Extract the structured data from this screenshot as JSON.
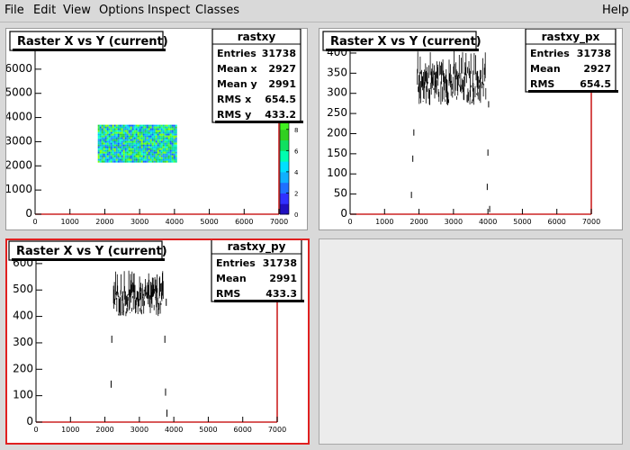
{
  "menu": {
    "file": "File",
    "edit": "Edit",
    "view": "View",
    "options": "Options",
    "inspect": "Inspect",
    "classes": "Classes",
    "help": "Help"
  },
  "pads": {
    "top_left": {
      "title": "Raster X vs Y (current)",
      "stats": {
        "name": "rastxy",
        "rows": [
          [
            "Entries",
            "31738"
          ],
          [
            "Mean x",
            "2927"
          ],
          [
            "Mean y",
            "2991"
          ],
          [
            "RMS x",
            "654.5"
          ],
          [
            "RMS y",
            "433.2"
          ]
        ]
      },
      "x_ticks": [
        "0",
        "1000",
        "2000",
        "3000",
        "4000",
        "5000",
        "6000",
        "7000"
      ],
      "y_ticks": [
        "0",
        "1000",
        "2000",
        "3000",
        "4000",
        "5000",
        "6000"
      ],
      "z_ticks": [
        "0",
        "2",
        "4",
        "6",
        "8"
      ]
    },
    "top_right": {
      "title": "Raster X vs Y (current)",
      "stats": {
        "name": "rastxy_px",
        "rows": [
          [
            "Entries",
            "31738"
          ],
          [
            "Mean",
            "2927"
          ],
          [
            "RMS",
            "654.5"
          ]
        ]
      },
      "x_ticks": [
        "0",
        "1000",
        "2000",
        "3000",
        "4000",
        "5000",
        "6000",
        "7000"
      ],
      "y_ticks": [
        "0",
        "50",
        "100",
        "150",
        "200",
        "250",
        "300",
        "350",
        "400"
      ]
    },
    "bottom_left": {
      "title": "Raster X vs Y (current)",
      "stats": {
        "name": "rastxy_py",
        "rows": [
          [
            "Entries",
            "31738"
          ],
          [
            "Mean",
            "2991"
          ],
          [
            "RMS",
            "433.3"
          ]
        ]
      },
      "x_ticks": [
        "0",
        "1000",
        "2000",
        "3000",
        "4000",
        "5000",
        "6000",
        "7000"
      ],
      "y_ticks": [
        "0",
        "100",
        "200",
        "300",
        "400",
        "500",
        "600"
      ]
    }
  },
  "colors": {
    "histogram_line": "#000000",
    "axis_frame": "#cc2222",
    "active_pad_border": "#e02020"
  },
  "chart_data": [
    {
      "type": "heatmap",
      "title": "Raster X vs Y (current)",
      "xlim": [
        0,
        7000
      ],
      "ylim": [
        0,
        7000
      ],
      "zlim": [
        0,
        9
      ],
      "filled_region": {
        "x": [
          1800,
          4050
        ],
        "y": [
          2200,
          3700
        ]
      },
      "stats": {
        "Entries": 31738,
        "Mean x": 2927,
        "Mean y": 2991,
        "RMS x": 654.5,
        "RMS y": 433.2
      }
    },
    {
      "type": "line",
      "title": "Raster X vs Y (current)",
      "xlim": [
        0,
        7000
      ],
      "ylim": [
        0,
        420
      ],
      "band": {
        "x": [
          1950,
          3950
        ],
        "y_min": 270,
        "y_max": 420
      },
      "edge_points": [
        [
          1780,
          40
        ],
        [
          1820,
          130
        ],
        [
          1850,
          195
        ],
        [
          3980,
          60
        ],
        [
          4000,
          145
        ],
        [
          4020,
          265
        ],
        [
          4050,
          5
        ]
      ],
      "stats": {
        "Entries": 31738,
        "Mean": 2927,
        "RMS": 654.5
      }
    },
    {
      "type": "line",
      "title": "Raster X vs Y (current)",
      "xlim": [
        0,
        7000
      ],
      "ylim": [
        0,
        620
      ],
      "band": {
        "x": [
          2250,
          3700
        ],
        "y_min": 400,
        "y_max": 590
      },
      "edge_points": [
        [
          2180,
          130
        ],
        [
          2200,
          300
        ],
        [
          3740,
          300
        ],
        [
          3760,
          100
        ],
        [
          3780,
          440
        ],
        [
          3800,
          20
        ]
      ],
      "stats": {
        "Entries": 31738,
        "Mean": 2991,
        "RMS": 433.3
      }
    }
  ]
}
